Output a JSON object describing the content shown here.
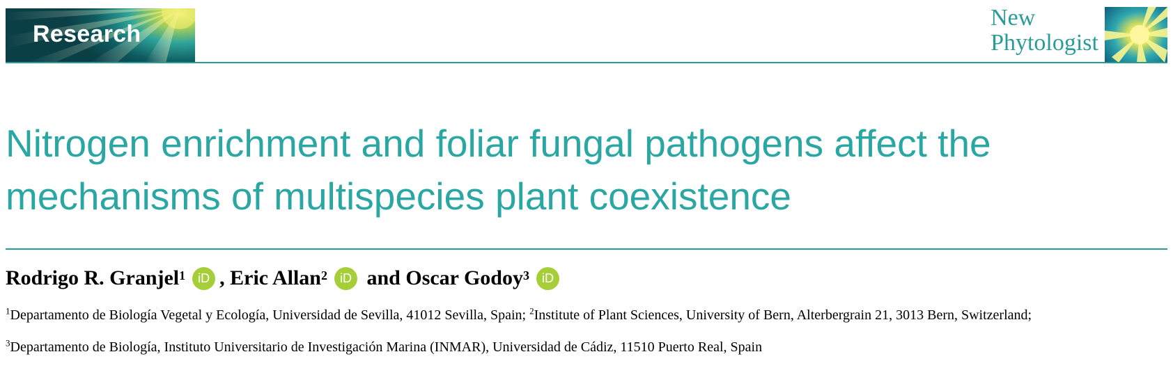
{
  "header": {
    "section_label": "Research",
    "journal_name_line1": "New",
    "journal_name_line2": "Phytologist"
  },
  "colors": {
    "accent_teal": "#2a9c98",
    "title_teal": "#2aa6a3",
    "orcid_green": "#a6ce39"
  },
  "article": {
    "title_line1": "Nitrogen enrichment and foliar fungal pathogens affect the",
    "title_line2": "mechanisms of multispecies plant coexistence"
  },
  "authors": [
    {
      "name": "Rodrigo R. Granjel",
      "affiliation": "1",
      "orcid_icon": "orcid-icon",
      "orcid_text": "iD"
    },
    {
      "name": "Eric Allan",
      "affiliation": "2",
      "orcid_icon": "orcid-icon",
      "orcid_text": "iD"
    },
    {
      "name": "Oscar Godoy",
      "affiliation": "3",
      "orcid_icon": "orcid-icon",
      "orcid_text": "iD"
    }
  ],
  "author_separators": [
    ", ",
    " and "
  ],
  "affiliations": [
    {
      "num": "1",
      "text": "Departamento de Biología Vegetal y Ecología, Universidad de Sevilla, 41012 Sevilla, Spain; "
    },
    {
      "num": "2",
      "text": "Institute of Plant Sciences, University of Bern, Alterbergrain 21, 3013 Bern, Switzerland;"
    },
    {
      "num": "3",
      "text": "Departamento de Biología, Instituto Universitario de Investigación Marina (INMAR), Universidad de Cádiz, 11510 Puerto Real, Spain"
    }
  ]
}
